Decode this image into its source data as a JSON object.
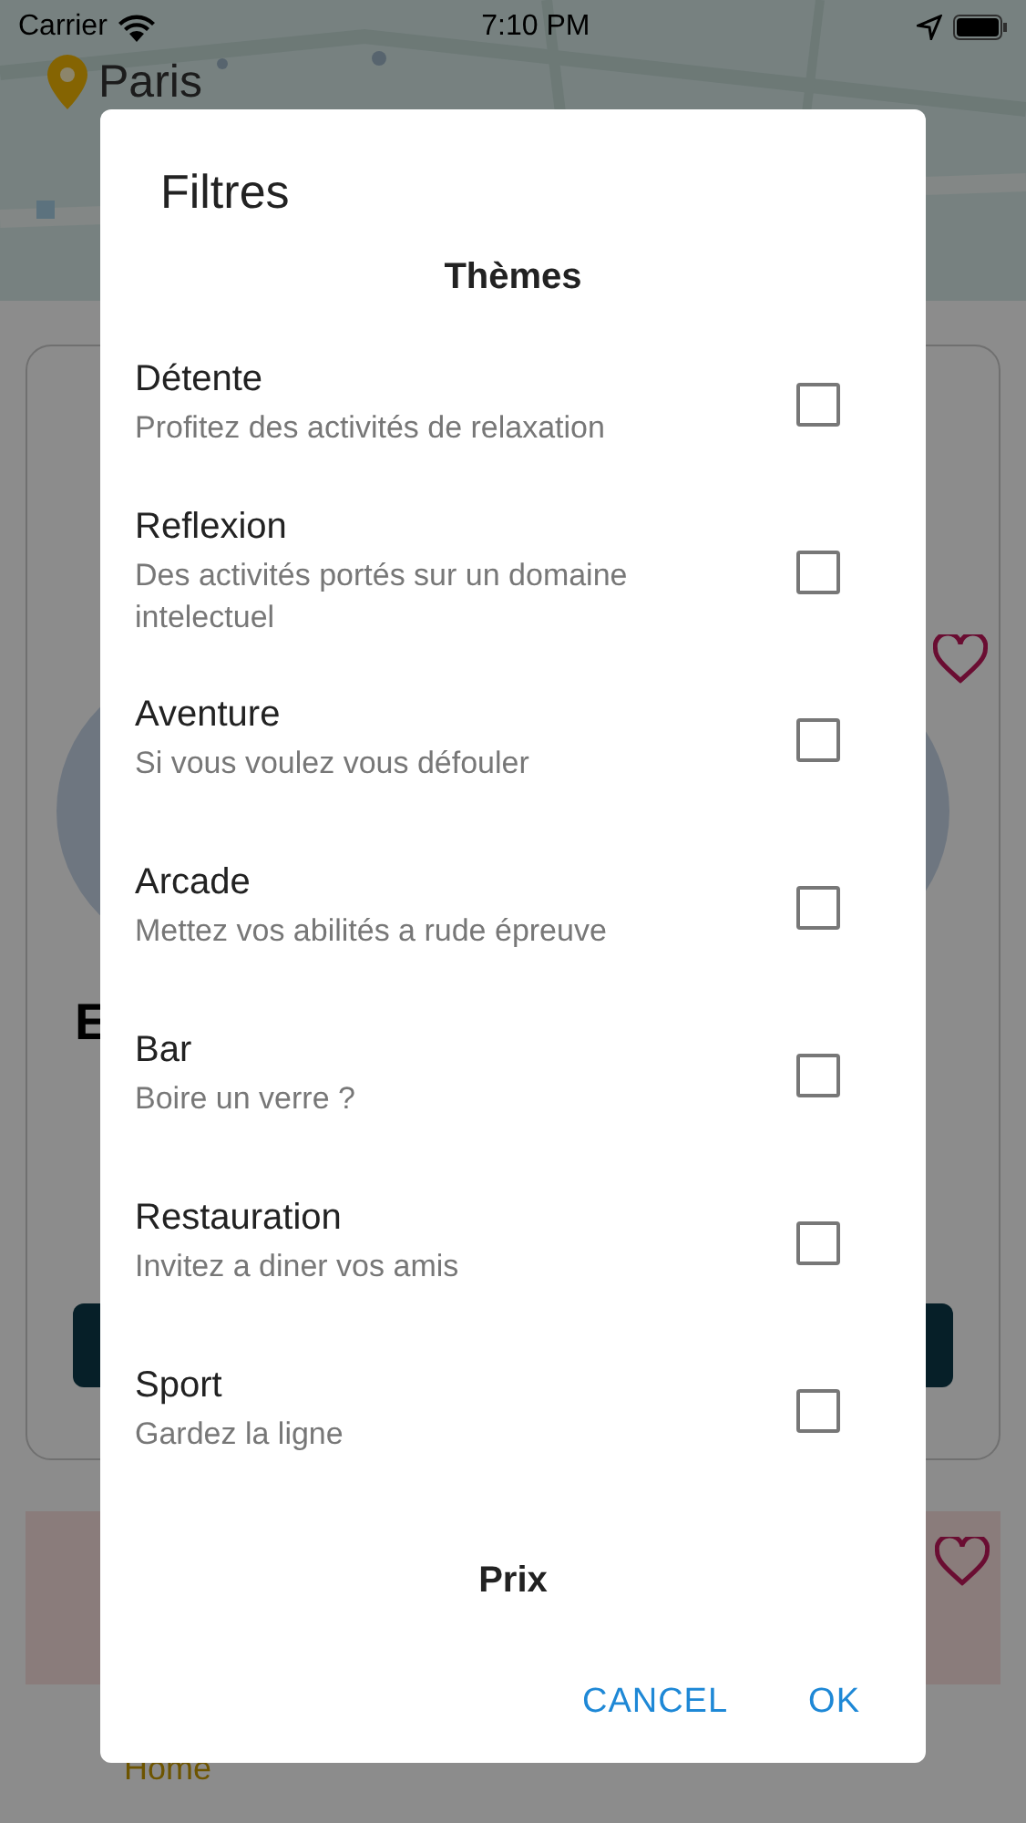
{
  "status_bar": {
    "carrier": "Carrier",
    "time": "7:10 PM"
  },
  "background": {
    "city": "Paris",
    "card_title": "E",
    "nav_items": [
      {
        "label": "Home",
        "selected": true
      }
    ]
  },
  "dialog": {
    "title": "Filtres",
    "themes_heading": "Thèmes",
    "themes": [
      {
        "title": "Détente",
        "description": "Profitez des activités de relaxation",
        "checked": false
      },
      {
        "title": "Reflexion",
        "description": "Des activités portés sur un domaine intelectuel",
        "checked": false
      },
      {
        "title": "Aventure",
        "description": "Si vous voulez vous défouler",
        "checked": false
      },
      {
        "title": "Arcade",
        "description": "Mettez vos abilités a rude épreuve",
        "checked": false
      },
      {
        "title": "Bar",
        "description": "Boire un verre ?",
        "checked": false
      },
      {
        "title": "Restauration",
        "description": "Invitez a diner vos amis",
        "checked": false
      },
      {
        "title": "Sport",
        "description": "Gardez la ligne",
        "checked": false
      }
    ],
    "price_heading": "Prix",
    "buttons": [
      "CANCEL",
      "OK"
    ]
  }
}
